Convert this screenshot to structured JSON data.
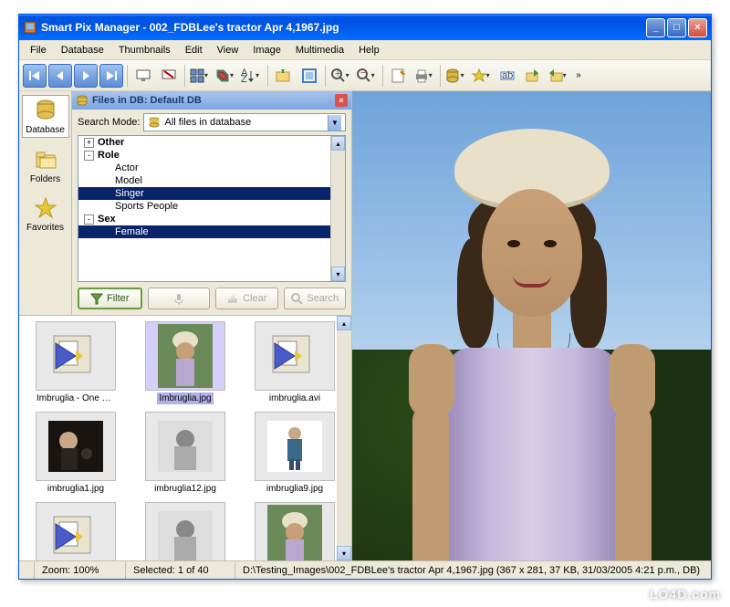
{
  "window": {
    "title": "Smart Pix Manager - 002_FDBLee's tractor Apr 4,1967.jpg"
  },
  "menu": {
    "items": [
      "File",
      "Database",
      "Thumbnails",
      "Edit",
      "View",
      "Image",
      "Multimedia",
      "Help"
    ]
  },
  "sidebar": {
    "items": [
      {
        "label": "Database",
        "icon": "database"
      },
      {
        "label": "Folders",
        "icon": "folder"
      },
      {
        "label": "Favorites",
        "icon": "star"
      }
    ]
  },
  "filter_panel": {
    "header": "Files in DB: Default DB",
    "search_mode_label": "Search Mode:",
    "search_mode_value": "All files in database",
    "tree": [
      {
        "label": "Other",
        "bold": true,
        "toggle": "+",
        "indent": 0,
        "selected": false
      },
      {
        "label": "Role",
        "bold": true,
        "toggle": "-",
        "indent": 0,
        "selected": false
      },
      {
        "label": "Actor",
        "bold": false,
        "toggle": "",
        "indent": 1,
        "selected": false
      },
      {
        "label": "Model",
        "bold": false,
        "toggle": "",
        "indent": 1,
        "selected": false
      },
      {
        "label": "Singer",
        "bold": false,
        "toggle": "",
        "indent": 1,
        "selected": true
      },
      {
        "label": "Sports People",
        "bold": false,
        "toggle": "",
        "indent": 1,
        "selected": false
      },
      {
        "label": "Sex",
        "bold": true,
        "toggle": "-",
        "indent": 0,
        "selected": false
      },
      {
        "label": "Female",
        "bold": false,
        "toggle": "",
        "indent": 1,
        "selected": true
      }
    ],
    "buttons": {
      "filter": "Filter",
      "clear": "Clear",
      "search": "Search"
    }
  },
  "thumbnails": [
    {
      "label": "Imbruglia - One M...",
      "kind": "video",
      "selected": false
    },
    {
      "label": "Imbruglia.jpg",
      "kind": "photo-color",
      "selected": true
    },
    {
      "label": "imbruglia.avi",
      "kind": "video",
      "selected": false
    },
    {
      "label": "imbruglia1.jpg",
      "kind": "photo-dark",
      "selected": false
    },
    {
      "label": "imbruglia12.jpg",
      "kind": "photo-bw",
      "selected": false
    },
    {
      "label": "imbruglia9.jpg",
      "kind": "photo-white",
      "selected": false
    },
    {
      "label": "",
      "kind": "video",
      "selected": false
    },
    {
      "label": "",
      "kind": "photo-bw",
      "selected": false
    },
    {
      "label": "",
      "kind": "photo-color",
      "selected": false
    }
  ],
  "status": {
    "zoom": "Zoom: 100%",
    "selected": "Selected: 1 of 40",
    "path": "D:\\Testing_Images\\002_FDBLee's tractor Apr 4,1967.jpg  (367 x 281, 37 KB, 31/03/2005 4:21 p.m., DB)"
  },
  "watermark": "LO4D.com"
}
